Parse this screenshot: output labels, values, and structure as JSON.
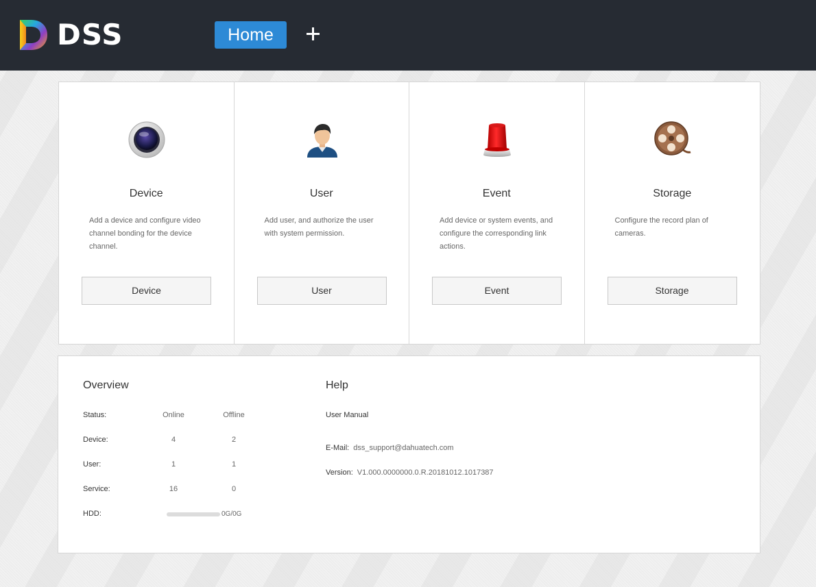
{
  "header": {
    "logo_text": "DSS",
    "tabs": [
      {
        "label": "Home",
        "active": true
      }
    ],
    "add_tab_icon": "plus-icon",
    "accent_color": "#2d8ad6",
    "bar_color": "#262b33"
  },
  "cards": [
    {
      "icon": "camera-icon",
      "title": "Device",
      "description": "Add a device and configure video channel bonding for the device channel.",
      "button": "Device"
    },
    {
      "icon": "user-icon",
      "title": "User",
      "description": "Add user, and authorize the user with system permission.",
      "button": "User"
    },
    {
      "icon": "alarm-light-icon",
      "title": "Event",
      "description": "Add device or system events, and configure the corresponding link actions.",
      "button": "Event"
    },
    {
      "icon": "film-reel-icon",
      "title": "Storage",
      "description": "Configure the record plan of cameras.",
      "button": "Storage"
    }
  ],
  "overview": {
    "title": "Overview",
    "status_label": "Status:",
    "online_label": "Online",
    "offline_label": "Offline",
    "rows": [
      {
        "label": "Device:",
        "online": "4",
        "offline": "2"
      },
      {
        "label": "User:",
        "online": "1",
        "offline": "1"
      },
      {
        "label": "Service:",
        "online": "16",
        "offline": "0"
      }
    ],
    "hdd_label": "HDD:",
    "hdd_value": "0G/0G",
    "hdd_usage_fraction": 0
  },
  "help": {
    "title": "Help",
    "manual_link": "User Manual",
    "email_label": "E-Mail:",
    "email_value": "dss_support@dahuatech.com",
    "version_label": "Version:",
    "version_value": "V1.000.0000000.0.R.20181012.1017387"
  }
}
